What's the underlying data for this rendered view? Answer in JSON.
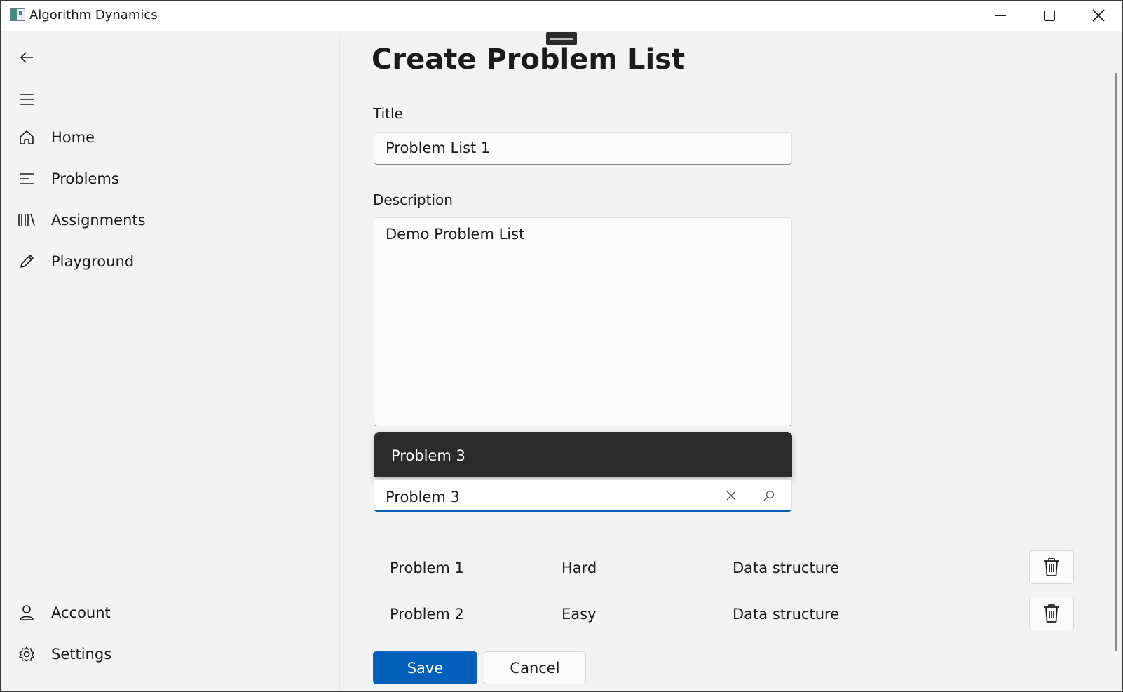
{
  "window": {
    "title": "Algorithm Dynamics",
    "controls": [
      "minimize-icon",
      "maximize-icon",
      "close-icon"
    ]
  },
  "nav": {
    "back_icon": "back-arrow-icon",
    "menu_icon": "hamburger-icon",
    "items": [
      {
        "label": "Home",
        "icon": "home-icon"
      },
      {
        "label": "Problems",
        "icon": "list-icon"
      },
      {
        "label": "Assignments",
        "icon": "library-icon"
      },
      {
        "label": "Playground",
        "icon": "pencil-icon"
      }
    ],
    "footer_items": [
      {
        "label": "Account",
        "icon": "person-icon"
      },
      {
        "label": "Settings",
        "icon": "gear-icon"
      }
    ]
  },
  "page": {
    "title": "Create Problem List",
    "title_field": {
      "label": "Title",
      "value": "Problem List 1"
    },
    "description_field": {
      "label": "Description",
      "value": "Demo Problem List"
    },
    "problem_search": {
      "value": "Problem 3",
      "suggestions": [
        "Problem 3"
      ]
    },
    "problems": [
      {
        "name": "Problem 1",
        "difficulty": "Hard",
        "category": "Data structure"
      },
      {
        "name": "Problem 2",
        "difficulty": "Easy",
        "category": "Data structure"
      }
    ],
    "save_label": "Save",
    "cancel_label": "Cancel"
  },
  "colors": {
    "accent": "#005fb8",
    "background": "#f3f3f3",
    "suggestion_bg": "#2b2b2b"
  }
}
